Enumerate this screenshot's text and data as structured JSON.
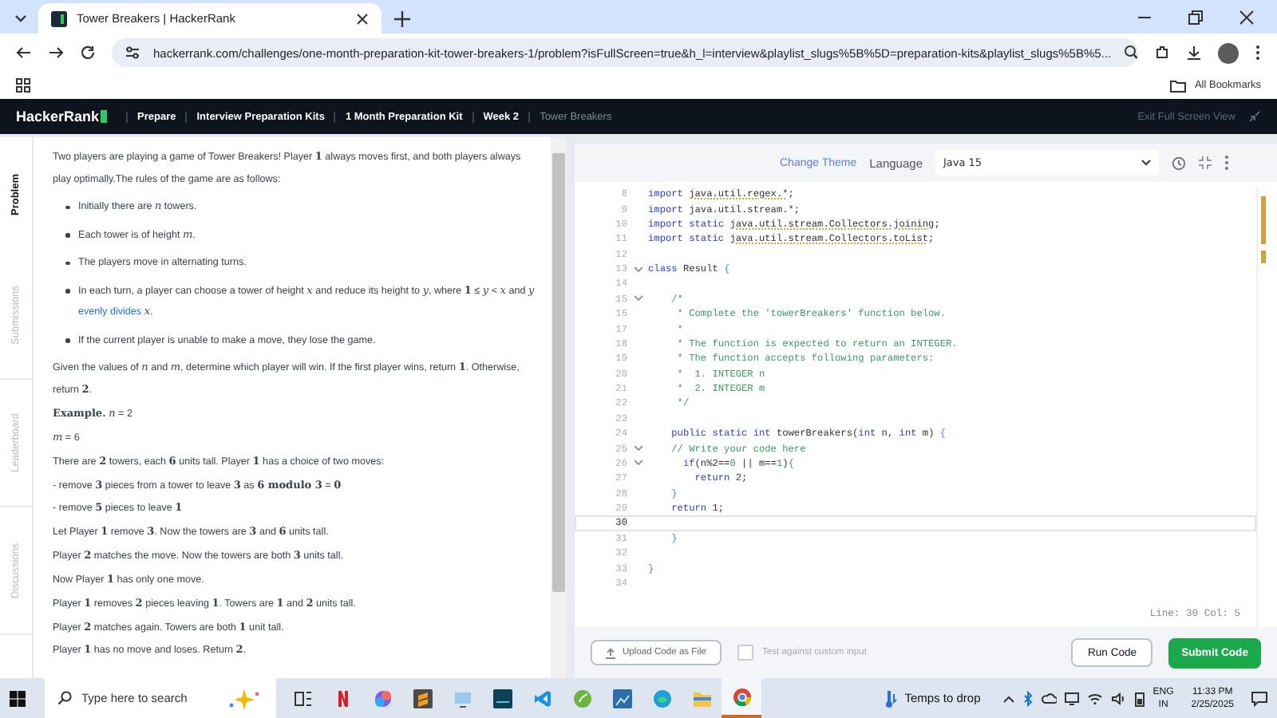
{
  "browser": {
    "tab_title": "Tower Breakers | HackerRank",
    "url": "hackerrank.com/challenges/one-month-preparation-kit-tower-breakers-1/problem?isFullScreen=true&h_l=interview&playlist_slugs%5B%5D=preparation-kits&playlist_slugs%5B%5...",
    "bookmarks_label": "All Bookmarks"
  },
  "site_nav": {
    "logo": "HackerRank",
    "breadcrumbs": [
      {
        "label": "Prepare",
        "current": false
      },
      {
        "label": "Interview Preparation Kits",
        "current": false
      },
      {
        "label": "1 Month Preparation Kit",
        "current": false
      },
      {
        "label": "Week 2",
        "current": false
      },
      {
        "label": "Tower Breakers",
        "current": true
      }
    ],
    "exit_label": "Exit Full Screen View"
  },
  "problem_tabs": [
    {
      "label": "Problem",
      "selected": true
    },
    {
      "label": "Submissions",
      "selected": false
    },
    {
      "label": "Leaderboard",
      "selected": false
    },
    {
      "label": "Discussions",
      "selected": false
    }
  ],
  "problem": [
    {
      "kind": "para",
      "text": "Two players are playing a game of Tower Breakers! Player **1** always moves first, and both players always play optimally.The rules of the game are as follows:"
    },
    {
      "kind": "bullet",
      "text": "Initially there are *n* towers."
    },
    {
      "kind": "bullet",
      "text": "Each tower is of height *m*."
    },
    {
      "kind": "bullet",
      "text": "The players move in alternating turns."
    },
    {
      "kind": "bullet",
      "text": "In each turn, a player can choose a tower of height *x* and reduce its height to *y*, where **1** ≤ *y* < *x* and *y* ",
      "link": "evenly divides",
      "after": " *x*."
    },
    {
      "kind": "bullet",
      "text": "If the current player is unable to make a move, they lose the game."
    },
    {
      "kind": "para",
      "text": "Given the values of *n* and *m*, determine which player will win. If the first player wins, return **1**. Otherwise, return **2**."
    },
    {
      "kind": "para",
      "text": "**Example.** *n* = 2"
    },
    {
      "kind": "para",
      "text": "*m* = 6"
    },
    {
      "kind": "para",
      "text": "There are **2** towers, each **6** units tall. Player **1** has a choice of two moves:"
    },
    {
      "kind": "line",
      "text": "- remove **3** pieces from a tower to leave **3** as **6 modulo 3** = **0**"
    },
    {
      "kind": "line",
      "text": "- remove **5** pieces to leave **1**"
    },
    {
      "kind": "para",
      "text": "Let Player **1** remove **3**. Now the towers are **3** and **6** units tall."
    },
    {
      "kind": "para",
      "text": "Player **2** matches the move. Now the towers are both **3** units tall."
    },
    {
      "kind": "para",
      "text": "Now Player **1** has only one move."
    },
    {
      "kind": "para",
      "text": "Player **1** removes **2** pieces leaving **1**. Towers are **1** and **2** units tall."
    },
    {
      "kind": "line",
      "text": "Player **2** matches again. Towers are both **1** unit tall."
    },
    {
      "kind": "para",
      "text": "Player **1** has no move and loses. Return **2**."
    }
  ],
  "editor": {
    "change_theme": "Change Theme",
    "language_label": "Language",
    "language": "Java 15",
    "lines": [
      {
        "number": "8",
        "fold": false,
        "current": false,
        "tokens": [
          {
            "kind": "keyword",
            "text": "import "
          },
          {
            "kind": "underlined",
            "text": "java.util.regex.*"
          },
          {
            "kind": "plain",
            "text": ";"
          }
        ]
      },
      {
        "number": "9",
        "fold": false,
        "current": false,
        "tokens": [
          {
            "kind": "keyword",
            "text": "import "
          },
          {
            "kind": "plain",
            "text": "java.util.stream.*;"
          }
        ]
      },
      {
        "number": "10",
        "fold": false,
        "current": false,
        "tokens": [
          {
            "kind": "keyword",
            "text": "import static "
          },
          {
            "kind": "underlined",
            "text": "java.util.stream.Collectors.joining"
          },
          {
            "kind": "plain",
            "text": ";"
          }
        ]
      },
      {
        "number": "11",
        "fold": false,
        "current": false,
        "tokens": [
          {
            "kind": "keyword",
            "text": "import static "
          },
          {
            "kind": "underlined",
            "text": "java.util.stream.Collectors.toList"
          },
          {
            "kind": "plain",
            "text": ";"
          }
        ]
      },
      {
        "number": "12",
        "fold": false,
        "current": false
      },
      {
        "number": "13",
        "fold": true,
        "current": false,
        "tokens": [
          {
            "kind": "keyword",
            "text": "class "
          },
          {
            "kind": "plain",
            "text": "Result "
          },
          {
            "kind": "brace",
            "text": "{"
          }
        ]
      },
      {
        "number": "14",
        "fold": false,
        "current": false
      },
      {
        "number": "15",
        "fold": true,
        "current": false,
        "tokens": [
          {
            "kind": "comment",
            "text": "    /*"
          }
        ]
      },
      {
        "number": "16",
        "fold": false,
        "current": false,
        "tokens": [
          {
            "kind": "comment",
            "text": "     * Complete the 'towerBreakers' function below."
          }
        ]
      },
      {
        "number": "17",
        "fold": false,
        "current": false,
        "tokens": [
          {
            "kind": "comment",
            "text": "     *"
          }
        ]
      },
      {
        "number": "18",
        "fold": false,
        "current": false,
        "tokens": [
          {
            "kind": "comment",
            "text": "     * The function is expected to return an INTEGER."
          }
        ]
      },
      {
        "number": "19",
        "fold": false,
        "current": false,
        "tokens": [
          {
            "kind": "comment",
            "text": "     * The function accepts following parameters:"
          }
        ]
      },
      {
        "number": "20",
        "fold": false,
        "current": false,
        "tokens": [
          {
            "kind": "comment",
            "text": "     *  1. INTEGER n"
          }
        ]
      },
      {
        "number": "21",
        "fold": false,
        "current": false,
        "tokens": [
          {
            "kind": "comment",
            "text": "     *  2. INTEGER m"
          }
        ]
      },
      {
        "number": "22",
        "fold": false,
        "current": false,
        "tokens": [
          {
            "kind": "comment",
            "text": "     */"
          }
        ]
      },
      {
        "number": "23",
        "fold": false,
        "current": false
      },
      {
        "number": "24",
        "fold": false,
        "current": false,
        "tokens": [
          {
            "kind": "keyword",
            "text": "    public static int "
          },
          {
            "kind": "plain",
            "text": "towerBreakers("
          },
          {
            "kind": "keyword",
            "text": "int "
          },
          {
            "kind": "plain",
            "text": "n, "
          },
          {
            "kind": "keyword",
            "text": "int "
          },
          {
            "kind": "plain",
            "text": "m) "
          },
          {
            "kind": "brace",
            "text": "{"
          }
        ]
      },
      {
        "number": "25",
        "fold": true,
        "current": false,
        "tokens": [
          {
            "kind": "comment",
            "text": "    // Write your code here"
          }
        ]
      },
      {
        "number": "26",
        "fold": true,
        "current": false,
        "tokens": [
          {
            "kind": "keyword",
            "text": "      if"
          },
          {
            "kind": "plain",
            "text": "(n%2=="
          },
          {
            "kind": "number",
            "text": "0"
          },
          {
            "kind": "plain",
            "text": " || m=="
          },
          {
            "kind": "number",
            "text": "1"
          },
          {
            "kind": "plain",
            "text": ")"
          },
          {
            "kind": "brace",
            "text": "{"
          }
        ]
      },
      {
        "number": "27",
        "fold": false,
        "current": false,
        "tokens": [
          {
            "kind": "keyword",
            "text": "        return "
          },
          {
            "kind": "plain",
            "text": "2;"
          }
        ]
      },
      {
        "number": "28",
        "fold": false,
        "current": false,
        "tokens": [
          {
            "kind": "brace",
            "text": "    }"
          }
        ]
      },
      {
        "number": "29",
        "fold": false,
        "current": false,
        "tokens": [
          {
            "kind": "keyword",
            "text": "    return "
          },
          {
            "kind": "plain",
            "text": "1;"
          }
        ]
      },
      {
        "number": "30",
        "fold": false,
        "current": true
      },
      {
        "number": "31",
        "fold": false,
        "current": false,
        "tokens": [
          {
            "kind": "brace",
            "text": "    }"
          }
        ]
      },
      {
        "number": "32",
        "fold": false,
        "current": false
      },
      {
        "number": "33",
        "fold": false,
        "current": false,
        "tokens": [
          {
            "kind": "brace",
            "text": "}"
          }
        ]
      },
      {
        "number": "34",
        "fold": false,
        "current": false
      }
    ],
    "status": "Line: 30 Col: 5"
  },
  "editor_footer": {
    "upload_label": "Upload Code as File",
    "custom_input": {
      "label": "Test against custom input",
      "checked": false
    },
    "run_label": "Run Code",
    "submit_label": "Submit Code"
  },
  "taskbar": {
    "search_placeholder": "Type here to search",
    "apps": [
      {
        "kind": "taskview",
        "active": false
      },
      {
        "kind": "netflix",
        "active": false
      },
      {
        "kind": "copilot",
        "active": false
      },
      {
        "kind": "sublime",
        "active": false
      },
      {
        "kind": "monitor",
        "active": false
      },
      {
        "kind": "terminal",
        "active": false
      },
      {
        "kind": "vscode",
        "active": false
      },
      {
        "kind": "spring",
        "active": false
      },
      {
        "kind": "photo",
        "active": false
      },
      {
        "kind": "edge",
        "active": false
      },
      {
        "kind": "files",
        "active": false
      },
      {
        "kind": "chrome",
        "active": true
      }
    ],
    "weather": "Temps to drop",
    "language": "ENG",
    "region": "IN",
    "time": "11:33 PM",
    "date": "2/25/2025"
  }
}
